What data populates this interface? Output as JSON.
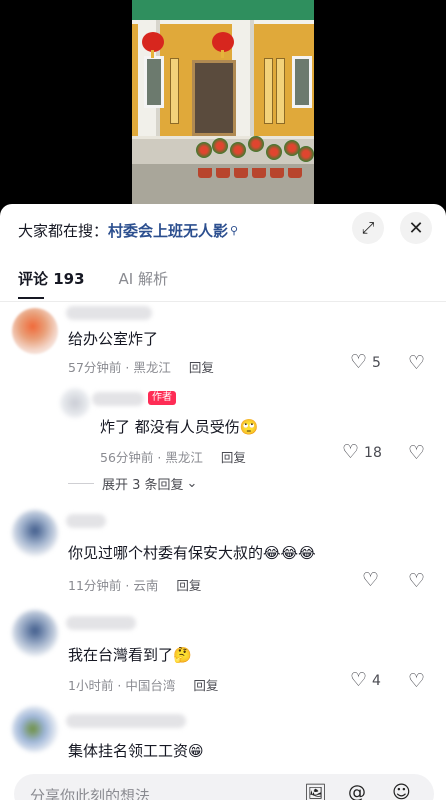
{
  "search": {
    "prefix": "大家都在搜：",
    "term": "村委会上班无人影",
    "term_icon": "search-icon"
  },
  "tabs": [
    {
      "label": "评论 193",
      "active": true
    },
    {
      "label": "AI 解析",
      "active": false
    }
  ],
  "comments": [
    {
      "text": "给办公室炸了",
      "emoji": "",
      "time": "57分钟前 · 黑龙江",
      "reply_label": "回复",
      "likes": "5"
    },
    {
      "author_badge": "作者",
      "text": "炸了 都没有人员受伤",
      "emoji": "🙄",
      "time": "56分钟前 · 黑龙江",
      "reply_label": "回复",
      "likes": "18"
    },
    {
      "text": "你见过哪个村委有保安大叔的",
      "emoji": "😂😂😂",
      "time": "11分钟前 · 云南",
      "reply_label": "回复",
      "likes": ""
    },
    {
      "text": "我在台灣看到了",
      "emoji": "🤔",
      "time": "1小时前 · 中国台湾",
      "reply_label": "回复",
      "likes": "4"
    },
    {
      "text": "集体挂名领工工资",
      "emoji": "😁",
      "time": "",
      "reply_label": "",
      "likes": ""
    }
  ],
  "expand_replies": "展开 3 条回复",
  "input": {
    "placeholder": "分享你此刻的想法"
  },
  "icons": {
    "expand": "expand-icon",
    "close": "close-icon",
    "like": "heart-icon",
    "dislike": "broken-heart-icon",
    "image": "image-icon",
    "mention": "at-icon",
    "emoji": "emoji-icon"
  },
  "colors": {
    "accent": "#fe2c55",
    "link": "#2c4f8f",
    "muted": "#8a8b91"
  }
}
